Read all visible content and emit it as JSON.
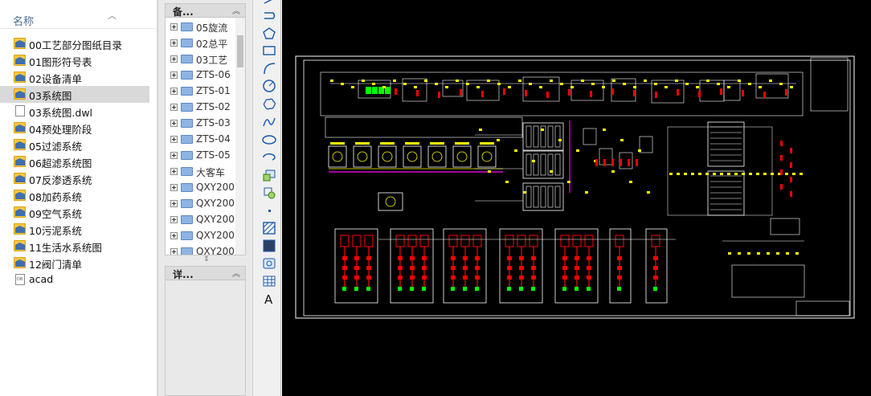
{
  "file_pane": {
    "column_header": "名称",
    "items": [
      {
        "name": "00工艺部分图纸目录",
        "type": "folder",
        "selected": false
      },
      {
        "name": "01图形符号表",
        "type": "folder",
        "selected": false
      },
      {
        "name": "02设备清单",
        "type": "folder",
        "selected": false
      },
      {
        "name": "03系统图",
        "type": "folder",
        "selected": true
      },
      {
        "name": "03系统图.dwl",
        "type": "file",
        "selected": false
      },
      {
        "name": "04预处理阶段",
        "type": "folder",
        "selected": false
      },
      {
        "name": "05过滤系统",
        "type": "folder",
        "selected": false
      },
      {
        "name": "06超滤系统图",
        "type": "folder",
        "selected": false
      },
      {
        "name": "07反渗透系统",
        "type": "folder",
        "selected": false
      },
      {
        "name": "08加药系统",
        "type": "folder",
        "selected": false
      },
      {
        "name": "09空气系统",
        "type": "folder",
        "selected": false
      },
      {
        "name": "10污泥系统",
        "type": "folder",
        "selected": false
      },
      {
        "name": "11生活水系统图",
        "type": "folder",
        "selected": false
      },
      {
        "name": "12阀门清单",
        "type": "folder",
        "selected": false
      },
      {
        "name": "acad",
        "type": "app",
        "selected": false
      }
    ]
  },
  "design_center": {
    "tree_title": "备...",
    "detail_title": "详...",
    "tree_items": [
      "05旋流",
      "02总平",
      "03工艺",
      "ZTS-06",
      "ZTS-01",
      "ZTS-02",
      "ZTS-03",
      "ZTS-04",
      "ZTS-05",
      "大客车",
      "QXY200",
      "QXY200",
      "QXY200",
      "QXY200",
      "QXY200"
    ]
  },
  "toolbar": {
    "tools": [
      "line-tool",
      "polyline-tool",
      "polygon-tool",
      "rectangle-tool",
      "arc-tool",
      "circle-tool",
      "revision-cloud-tool",
      "spline-tool",
      "ellipse-tool",
      "ellipse-arc-tool",
      "insert-block-tool",
      "make-block-tool",
      "point-tool",
      "hatch-tool",
      "gradient-tool",
      "region-tool",
      "table-tool",
      "multiline-text-tool"
    ],
    "text_tool_label": "A"
  },
  "colors": {
    "canvas_bg": "#000000",
    "frame": "#ffffff",
    "yellow": "#ffff00",
    "red": "#ff0000",
    "magenta": "#ff00ff",
    "green": "#00ff00"
  }
}
